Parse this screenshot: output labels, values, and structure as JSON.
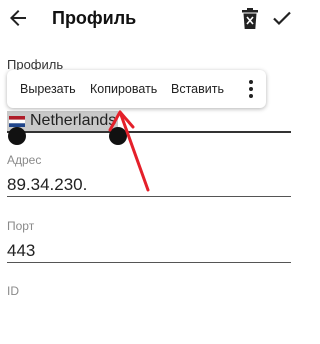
{
  "header": {
    "title": "Профиль"
  },
  "fields": {
    "profile": {
      "label": "Профиль",
      "value": "Netherlands"
    },
    "address": {
      "label": "Адрес",
      "value": "89.34.230."
    },
    "port": {
      "label": "Порт",
      "value": "443"
    },
    "id": {
      "label": "ID"
    }
  },
  "context_menu": {
    "cut": "Вырезать",
    "copy": "Копировать",
    "paste": "Вставить"
  },
  "colors": {
    "annotation_arrow": "#e4202a",
    "selection": "#c9c9c9"
  }
}
